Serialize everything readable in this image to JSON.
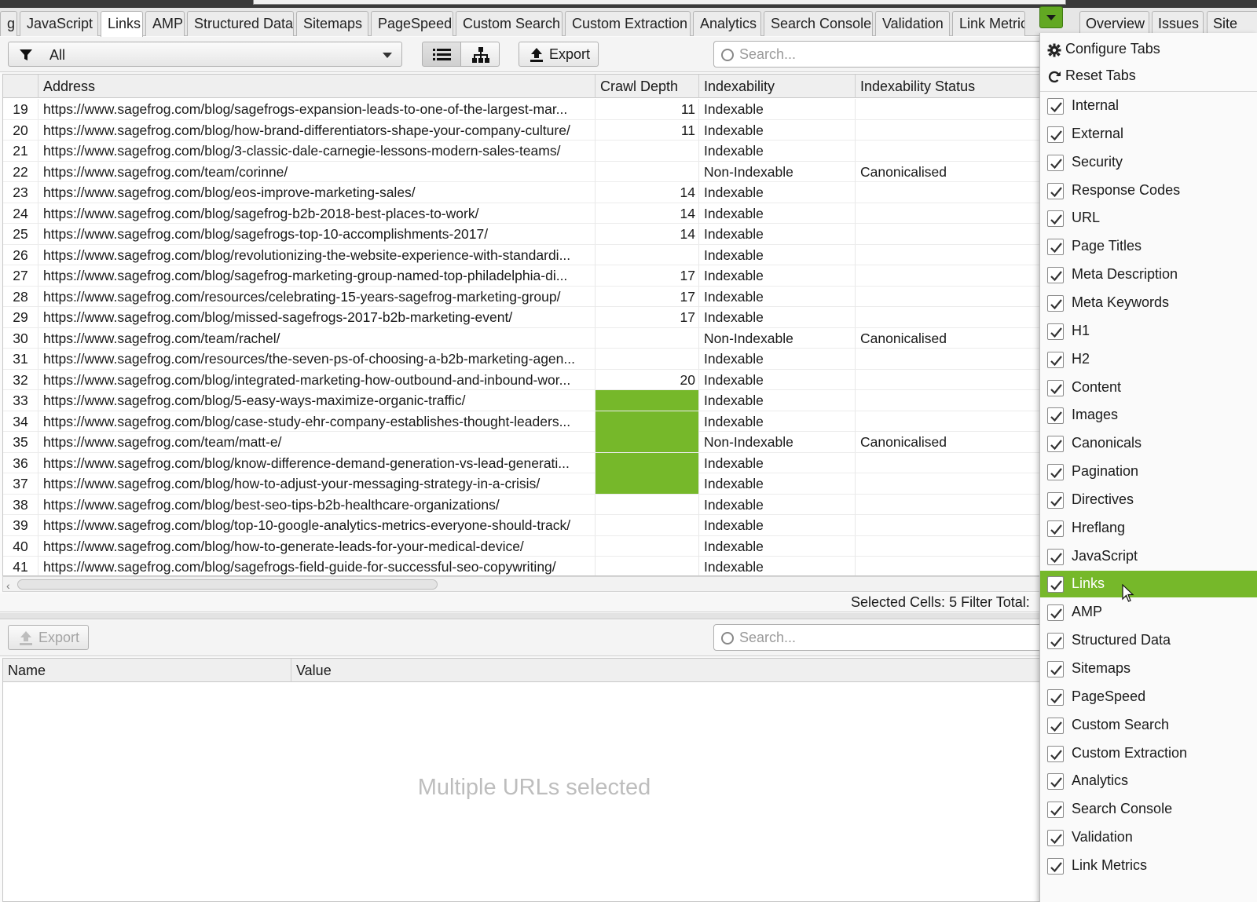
{
  "tabs": [
    {
      "label": "g",
      "active": false
    },
    {
      "label": "JavaScript",
      "active": false
    },
    {
      "label": "Links",
      "active": true
    },
    {
      "label": "AMP",
      "active": false
    },
    {
      "label": "Structured Data",
      "active": false
    },
    {
      "label": "Sitemaps",
      "active": false
    },
    {
      "label": "PageSpeed",
      "active": false
    },
    {
      "label": "Custom Search",
      "active": false
    },
    {
      "label": "Custom Extraction",
      "active": false
    },
    {
      "label": "Analytics",
      "active": false
    },
    {
      "label": "Search Console",
      "active": false
    },
    {
      "label": "Validation",
      "active": false
    },
    {
      "label": "Link Metric",
      "active": false
    }
  ],
  "right_tabs": [
    {
      "label": "Overview"
    },
    {
      "label": "Issues"
    },
    {
      "label": "Site"
    }
  ],
  "toolbar": {
    "filter_value": "All",
    "export_label": "Export",
    "search_placeholder": "Search..."
  },
  "table": {
    "headers": [
      "",
      "Address",
      "Crawl Depth",
      "Indexability",
      "Indexability Status"
    ],
    "rows": [
      {
        "n": "19",
        "url": "https://www.sagefrog.com/blog/sagefrogs-expansion-leads-to-one-of-the-largest-mar...",
        "depth": "11",
        "idx": "Indexable",
        "status": "",
        "sel": false
      },
      {
        "n": "20",
        "url": "https://www.sagefrog.com/blog/how-brand-differentiators-shape-your-company-culture/",
        "depth": "11",
        "idx": "Indexable",
        "status": "",
        "sel": false
      },
      {
        "n": "21",
        "url": "https://www.sagefrog.com/blog/3-classic-dale-carnegie-lessons-modern-sales-teams/",
        "depth": "",
        "idx": "Indexable",
        "status": "",
        "sel": false
      },
      {
        "n": "22",
        "url": "https://www.sagefrog.com/team/corinne/",
        "depth": "",
        "idx": "Non-Indexable",
        "status": "Canonicalised",
        "sel": false
      },
      {
        "n": "23",
        "url": "https://www.sagefrog.com/blog/eos-improve-marketing-sales/",
        "depth": "14",
        "idx": "Indexable",
        "status": "",
        "sel": false
      },
      {
        "n": "24",
        "url": "https://www.sagefrog.com/blog/sagefrog-b2b-2018-best-places-to-work/",
        "depth": "14",
        "idx": "Indexable",
        "status": "",
        "sel": false
      },
      {
        "n": "25",
        "url": "https://www.sagefrog.com/blog/sagefrogs-top-10-accomplishments-2017/",
        "depth": "14",
        "idx": "Indexable",
        "status": "",
        "sel": false
      },
      {
        "n": "26",
        "url": "https://www.sagefrog.com/blog/revolutionizing-the-website-experience-with-standardi...",
        "depth": "",
        "idx": "Indexable",
        "status": "",
        "sel": false
      },
      {
        "n": "27",
        "url": "https://www.sagefrog.com/blog/sagefrog-marketing-group-named-top-philadelphia-di...",
        "depth": "17",
        "idx": "Indexable",
        "status": "",
        "sel": false
      },
      {
        "n": "28",
        "url": "https://www.sagefrog.com/resources/celebrating-15-years-sagefrog-marketing-group/",
        "depth": "17",
        "idx": "Indexable",
        "status": "",
        "sel": false
      },
      {
        "n": "29",
        "url": "https://www.sagefrog.com/blog/missed-sagefrogs-2017-b2b-marketing-event/",
        "depth": "17",
        "idx": "Indexable",
        "status": "",
        "sel": false
      },
      {
        "n": "30",
        "url": "https://www.sagefrog.com/team/rachel/",
        "depth": "",
        "idx": "Non-Indexable",
        "status": "Canonicalised",
        "sel": false
      },
      {
        "n": "31",
        "url": "https://www.sagefrog.com/resources/the-seven-ps-of-choosing-a-b2b-marketing-agen...",
        "depth": "",
        "idx": "Indexable",
        "status": "",
        "sel": false
      },
      {
        "n": "32",
        "url": "https://www.sagefrog.com/blog/integrated-marketing-how-outbound-and-inbound-wor...",
        "depth": "20",
        "idx": "Indexable",
        "status": "",
        "sel": false
      },
      {
        "n": "33",
        "url": "https://www.sagefrog.com/blog/5-easy-ways-maximize-organic-traffic/",
        "depth": "",
        "idx": "Indexable",
        "status": "",
        "sel": true
      },
      {
        "n": "34",
        "url": "https://www.sagefrog.com/blog/case-study-ehr-company-establishes-thought-leaders...",
        "depth": "",
        "idx": "Indexable",
        "status": "",
        "sel": true
      },
      {
        "n": "35",
        "url": "https://www.sagefrog.com/team/matt-e/",
        "depth": "",
        "idx": "Non-Indexable",
        "status": "Canonicalised",
        "sel": true
      },
      {
        "n": "36",
        "url": "https://www.sagefrog.com/blog/know-difference-demand-generation-vs-lead-generati...",
        "depth": "",
        "idx": "Indexable",
        "status": "",
        "sel": true
      },
      {
        "n": "37",
        "url": "https://www.sagefrog.com/blog/how-to-adjust-your-messaging-strategy-in-a-crisis/",
        "depth": "",
        "idx": "Indexable",
        "status": "",
        "sel": true
      },
      {
        "n": "38",
        "url": "https://www.sagefrog.com/blog/best-seo-tips-b2b-healthcare-organizations/",
        "depth": "",
        "idx": "Indexable",
        "status": "",
        "sel": false
      },
      {
        "n": "39",
        "url": "https://www.sagefrog.com/blog/top-10-google-analytics-metrics-everyone-should-track/",
        "depth": "",
        "idx": "Indexable",
        "status": "",
        "sel": false
      },
      {
        "n": "40",
        "url": "https://www.sagefrog.com/blog/how-to-generate-leads-for-your-medical-device/",
        "depth": "",
        "idx": "Indexable",
        "status": "",
        "sel": false
      },
      {
        "n": "41",
        "url": "https://www.sagefrog.com/blog/sagefrogs-field-guide-for-successful-seo-copywriting/",
        "depth": "",
        "idx": "Indexable",
        "status": "",
        "sel": false
      }
    ]
  },
  "status": {
    "selected_cells_label": "Selected Cells:",
    "selected_cells_value": "5",
    "filter_total_label": "Filter Total:"
  },
  "lower": {
    "export_label": "Export",
    "search_placeholder": "Search...",
    "headers": [
      "Name",
      "Value"
    ],
    "empty_message": "Multiple URLs selected"
  },
  "menu": {
    "actions": [
      {
        "label": "Configure Tabs",
        "icon": "gear-icon"
      },
      {
        "label": "Reset Tabs",
        "icon": "refresh-icon"
      }
    ],
    "items": [
      {
        "label": "Internal",
        "checked": true,
        "highlight": false
      },
      {
        "label": "External",
        "checked": true,
        "highlight": false
      },
      {
        "label": "Security",
        "checked": true,
        "highlight": false
      },
      {
        "label": "Response Codes",
        "checked": true,
        "highlight": false
      },
      {
        "label": "URL",
        "checked": true,
        "highlight": false
      },
      {
        "label": "Page Titles",
        "checked": true,
        "highlight": false
      },
      {
        "label": "Meta Description",
        "checked": true,
        "highlight": false
      },
      {
        "label": "Meta Keywords",
        "checked": true,
        "highlight": false
      },
      {
        "label": "H1",
        "checked": true,
        "highlight": false
      },
      {
        "label": "H2",
        "checked": true,
        "highlight": false
      },
      {
        "label": "Content",
        "checked": true,
        "highlight": false
      },
      {
        "label": "Images",
        "checked": true,
        "highlight": false
      },
      {
        "label": "Canonicals",
        "checked": true,
        "highlight": false
      },
      {
        "label": "Pagination",
        "checked": true,
        "highlight": false
      },
      {
        "label": "Directives",
        "checked": true,
        "highlight": false
      },
      {
        "label": "Hreflang",
        "checked": true,
        "highlight": false
      },
      {
        "label": "JavaScript",
        "checked": true,
        "highlight": false
      },
      {
        "label": "Links",
        "checked": true,
        "highlight": true
      },
      {
        "label": "AMP",
        "checked": true,
        "highlight": false
      },
      {
        "label": "Structured Data",
        "checked": true,
        "highlight": false
      },
      {
        "label": "Sitemaps",
        "checked": true,
        "highlight": false
      },
      {
        "label": "PageSpeed",
        "checked": true,
        "highlight": false
      },
      {
        "label": "Custom Search",
        "checked": true,
        "highlight": false
      },
      {
        "label": "Custom Extraction",
        "checked": true,
        "highlight": false
      },
      {
        "label": "Analytics",
        "checked": true,
        "highlight": false
      },
      {
        "label": "Search Console",
        "checked": true,
        "highlight": false
      },
      {
        "label": "Validation",
        "checked": true,
        "highlight": false
      },
      {
        "label": "Link Metrics",
        "checked": true,
        "highlight": false
      }
    ]
  },
  "colors": {
    "accent_green": "#76b82a",
    "dropdown_green": "#62a822"
  }
}
